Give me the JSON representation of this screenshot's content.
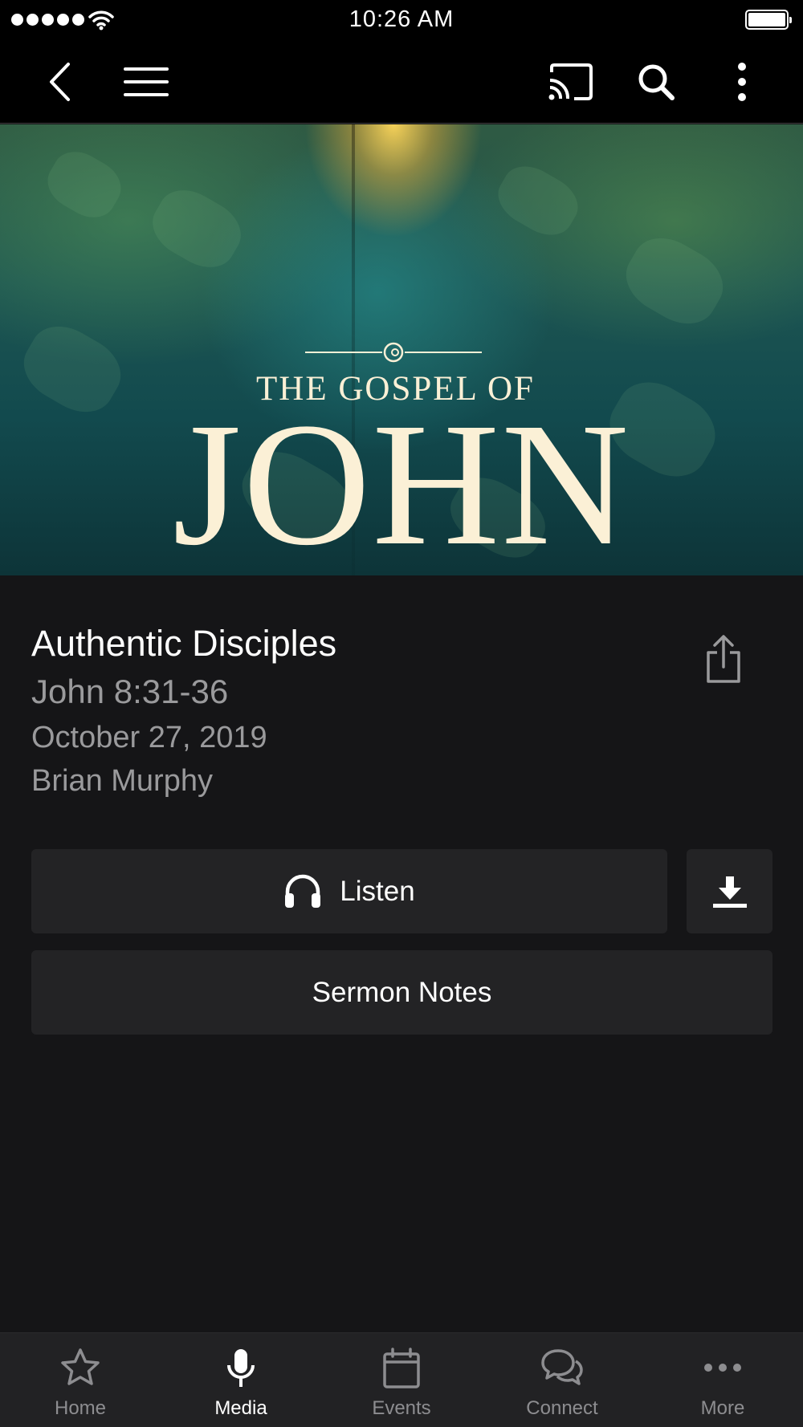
{
  "status_bar": {
    "time": "10:26 AM"
  },
  "nav": {
    "icons": [
      "back-icon",
      "menu-icon",
      "cast-icon",
      "search-icon",
      "more-vertical-icon"
    ]
  },
  "hero": {
    "subtitle": "THE GOSPEL OF",
    "title": "JOHN"
  },
  "sermon": {
    "title": "Authentic Disciples",
    "reference": "John 8:31-36",
    "date": "October 27, 2019",
    "speaker": "Brian Murphy"
  },
  "actions": {
    "listen_label": "Listen",
    "notes_label": "Sermon Notes"
  },
  "tabs": [
    {
      "label": "Home",
      "icon": "star-icon",
      "active": false
    },
    {
      "label": "Media",
      "icon": "microphone-icon",
      "active": true
    },
    {
      "label": "Events",
      "icon": "calendar-icon",
      "active": false
    },
    {
      "label": "Connect",
      "icon": "chat-bubbles-icon",
      "active": false
    },
    {
      "label": "More",
      "icon": "ellipsis-icon",
      "active": false
    }
  ],
  "colors": {
    "background": "#151517",
    "button": "#232325",
    "secondary_text": "#9a9a9c",
    "tab_inactive": "#8d8d90"
  }
}
